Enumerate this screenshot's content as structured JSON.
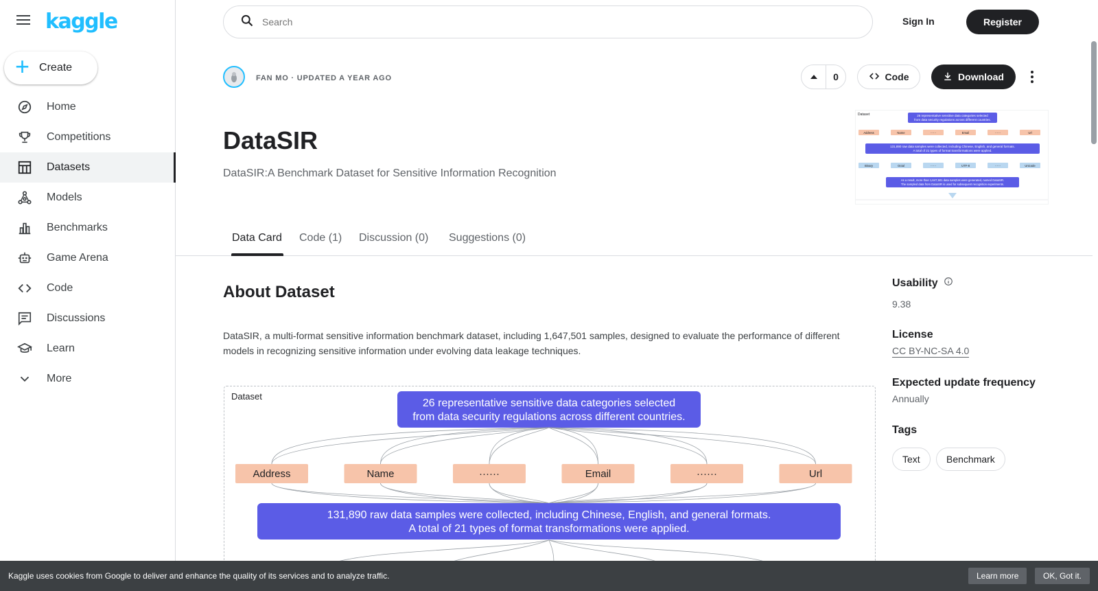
{
  "app": {
    "logo": "kaggle"
  },
  "sidebar": {
    "create_label": "Create",
    "items": [
      {
        "label": "Home",
        "icon": "compass-icon"
      },
      {
        "label": "Competitions",
        "icon": "trophy-icon"
      },
      {
        "label": "Datasets",
        "icon": "table-icon",
        "active": true
      },
      {
        "label": "Models",
        "icon": "models-icon"
      },
      {
        "label": "Benchmarks",
        "icon": "bar-chart-icon"
      },
      {
        "label": "Game Arena",
        "icon": "robot-icon"
      },
      {
        "label": "Code",
        "icon": "code-icon"
      },
      {
        "label": "Discussions",
        "icon": "comment-icon"
      },
      {
        "label": "Learn",
        "icon": "school-icon"
      },
      {
        "label": "More",
        "icon": "chevron-down-icon"
      }
    ]
  },
  "header": {
    "search_placeholder": "Search",
    "signin_label": "Sign In",
    "register_label": "Register"
  },
  "dataset": {
    "meta": "FAN MO · UPDATED A YEAR AGO",
    "vote_count": "0",
    "code_label": "Code",
    "download_label": "Download",
    "title": "DataSIR",
    "subtitle": "DataSIR:A Benchmark Dataset for Sensitive Information Recognition"
  },
  "thumbnail": {
    "label": "Dataset",
    "top_line1": "26 representative sensitive data categories selected",
    "top_line2": "from data security regulations across different countries.",
    "row1": [
      "Address",
      "Name",
      "······",
      "Email",
      "······",
      "Url"
    ],
    "mid_line1": "131,890 raw data samples were collected, including Chinese, English, and general formats.",
    "mid_line2": "A total of 21 types of format transformations were applied.",
    "row2": [
      "Binary",
      "Octal",
      "······",
      "UTF-8",
      "······",
      "Unicode"
    ],
    "bottom_line1": "As a result, more than 1,647,501 data samples were generated, named DataSIR.",
    "bottom_line2": "The sampled data from DataSIR is used for subsequent recognition experiments."
  },
  "tabs": [
    "Data Card",
    "Code (1)",
    "Discussion (0)",
    "Suggestions (0)"
  ],
  "about": {
    "heading": "About Dataset",
    "description": "DataSIR, a multi-format sensitive information benchmark dataset, including 1,647,501 samples, designed to evaluate the performance of different models in recognizing sensitive information under evolving data leakage techniques."
  },
  "diagram": {
    "label": "Dataset",
    "top_line1": "26 representative sensitive data categories selected",
    "top_line2": "from data security regulations across different countries.",
    "categories": [
      "Address",
      "Name",
      "······",
      "Email",
      "······",
      "Url"
    ],
    "mid_line1": "131,890 raw data samples were collected, including Chinese, English, and general formats.",
    "mid_line2": "A total of 21 types of format transformations were applied."
  },
  "side": {
    "usability_label": "Usability",
    "usability_value": "9.38",
    "license_label": "License",
    "license_value": "CC BY-NC-SA 4.0",
    "frequency_label": "Expected update frequency",
    "frequency_value": "Annually",
    "tags_label": "Tags",
    "tags": [
      "Text",
      "Benchmark"
    ]
  },
  "cookie": {
    "message": "Kaggle uses cookies from Google to deliver and enhance the quality of its services and to analyze traffic.",
    "learn_more": "Learn more",
    "ok": "OK, Got it."
  },
  "colors": {
    "brand": "#20beff",
    "diagram_blue": "#5b5ce6",
    "diagram_peach": "#f7c4aa",
    "diagram_lightblue": "#b9d7f0"
  }
}
